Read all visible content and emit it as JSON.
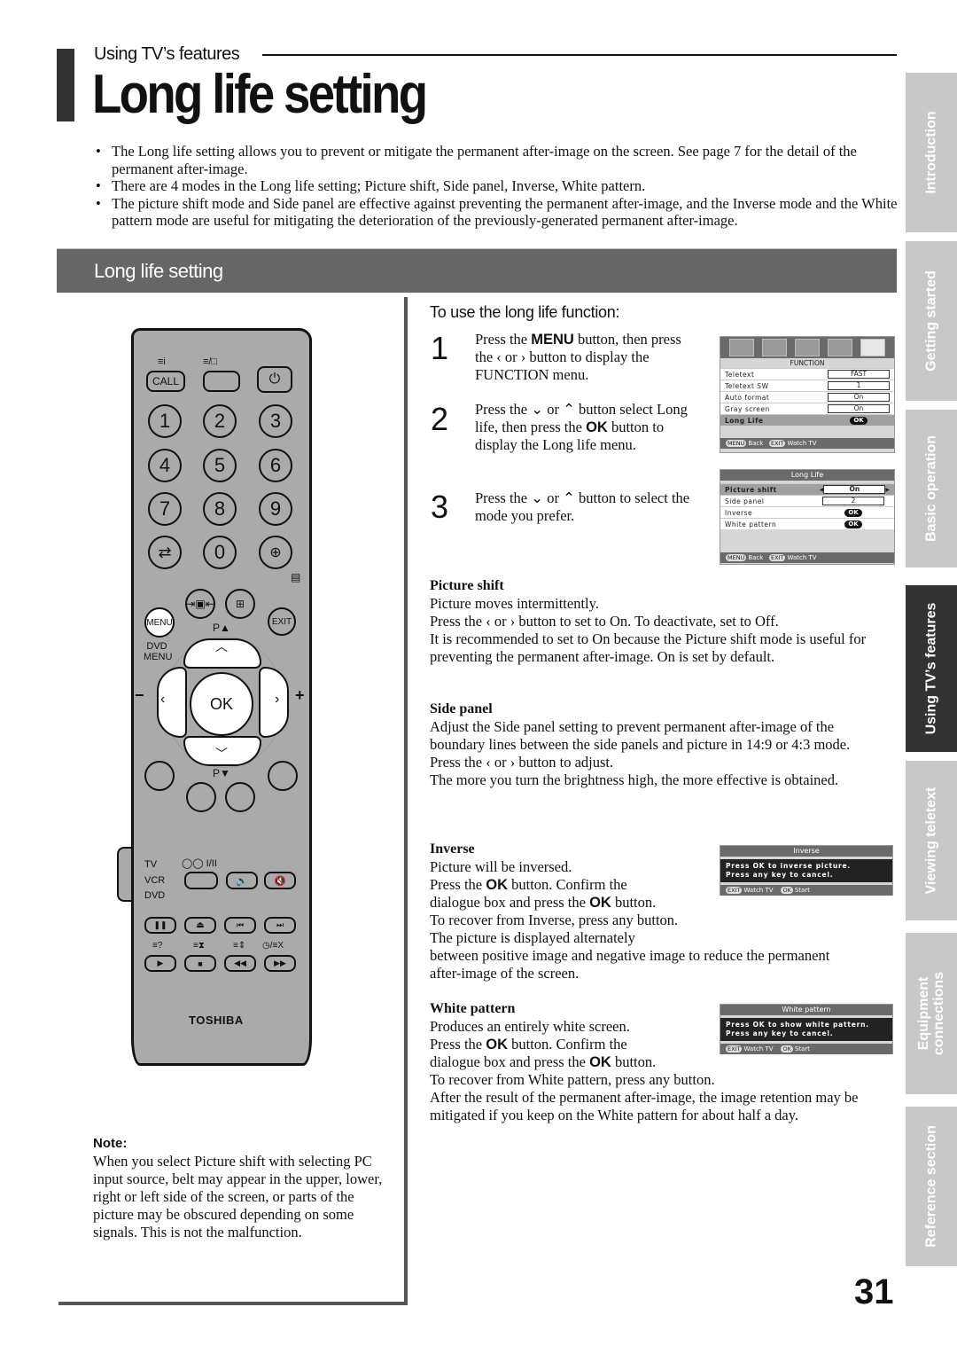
{
  "header": {
    "section": "Using TV’s features",
    "title": "Long life setting"
  },
  "intro_bullets": [
    "The Long life setting allows you to prevent or mitigate the permanent after-image on the screen. See page 7 for the detail of the permanent after-image.",
    "There are 4 modes in the Long life setting; Picture shift, Side panel, Inverse, White pattern.",
    "The picture shift mode and Side panel are effective against preventing the permanent after-image, and the Inverse mode and the White pattern mode are useful for mitigating the deterioration of the previously-generated permanent after-image."
  ],
  "band_title": "Long life setting",
  "side_tabs": [
    {
      "label": "Introduction",
      "active": false
    },
    {
      "label": "Getting started",
      "active": false
    },
    {
      "label": "Basic operation",
      "active": false
    },
    {
      "label": "Using TV’s features",
      "active": true
    },
    {
      "label": "Viewing teletext",
      "active": false
    },
    {
      "label": "Equipment connections",
      "active": false
    },
    {
      "label": "Reference section",
      "active": false
    }
  ],
  "remote": {
    "top_labels": {
      "call": "CALL",
      "text_icon": "≡i",
      "text_mix": "≡/□"
    },
    "numbers": [
      "1",
      "2",
      "3",
      "4",
      "5",
      "6",
      "7",
      "8",
      "9",
      "0"
    ],
    "menu": "MENU",
    "exit": "EXIT",
    "dvd_menu": "DVD MENU",
    "p_up": "P▲",
    "p_down": "P▼",
    "ok": "OK",
    "vol_minus": "−",
    "vol_plus": "+",
    "source": [
      "TV",
      "VCR",
      "DVD"
    ],
    "dual": "◯◯ I/II",
    "brand": "TOSHIBA"
  },
  "steps": {
    "heading": "To use the long life function:",
    "items": [
      {
        "num": "1",
        "parts": [
          "Press the ",
          "MENU",
          " button, then press the ‹ or › button to display the FUNCTION menu."
        ]
      },
      {
        "num": "2",
        "parts": [
          "Press the ⌄ or ⌃ button select Long life, then press the ",
          "OK",
          " button to display the Long life menu."
        ]
      },
      {
        "num": "3",
        "parts": [
          "Press the ⌄ or ⌃ button to select the mode you prefer."
        ]
      }
    ]
  },
  "osd_function": {
    "caption": "FUNCTION",
    "rows": [
      {
        "label": "Teletext",
        "value": "FAST"
      },
      {
        "label": "Teletext SW",
        "value": "1"
      },
      {
        "label": "Auto format",
        "value": "On"
      },
      {
        "label": "Gray screen",
        "value": "On"
      },
      {
        "label": "Long Life",
        "value": "OK",
        "highlight": true
      }
    ],
    "footer_menu": "MENU",
    "footer_back": "Back",
    "footer_exit": "EXIT",
    "footer_watch": "Watch TV"
  },
  "osd_longlife": {
    "title": "Long Life",
    "rows": [
      {
        "label": "Picture shift",
        "value": "On",
        "highlight": true
      },
      {
        "label": "Side panel",
        "value": "2"
      },
      {
        "label": "Inverse",
        "value": "OK"
      },
      {
        "label": "White pattern",
        "value": "OK"
      }
    ],
    "footer_menu": "MENU",
    "footer_back": "Back",
    "footer_exit": "EXIT",
    "footer_watch": "Watch TV"
  },
  "modes": {
    "picture_shift": {
      "title": "Picture shift",
      "lines": [
        "Picture moves intermittently.",
        "Press the ‹ or › button to set to On. To deactivate, set to Off.",
        "It is recommended to set to On because the Picture shift mode is useful for preventing the permanent after-image. On is set by default."
      ]
    },
    "side_panel": {
      "title": "Side panel",
      "lines": [
        "Adjust the Side panel setting to prevent permanent after-image of the boundary lines between the side panels and picture in 14:9 or 4:3 mode.",
        "Press the ‹ or › button to adjust.",
        "The more you turn the brightness high, the more effective is obtained."
      ]
    },
    "inverse": {
      "title": "Inverse",
      "line1": "Picture will be inversed.",
      "line2a": "Press the ",
      "ok": "OK",
      "line2b": " button. Confirm the",
      "line3a": "dialogue box and press the ",
      "line3b": " button.",
      "rest": [
        "To recover from Inverse, press any button.",
        "The picture is displayed alternately",
        "between positive image and negative image to reduce the permanent after-image of the screen."
      ],
      "osd": {
        "title": "Inverse",
        "msg1": "Press OK to inverse picture.",
        "msg2": "Press any key to cancel.",
        "exit": "EXIT",
        "watch": "Watch TV",
        "ok": "OK",
        "start": "Start"
      }
    },
    "white_pattern": {
      "title": "White pattern",
      "line1": "Produces an entirely white screen.",
      "line2a": "Press the ",
      "ok": "OK",
      "line2b": " button. Confirm the",
      "line3a": "dialogue box and press the ",
      "line3b": " button.",
      "rest": [
        "To recover from White pattern, press any button.",
        "After the result of the permanent after-image, the image retention may be mitigated if you keep on the White pattern for about half a day."
      ],
      "osd": {
        "title": "White pattern",
        "msg1": "Press OK to show white pattern.",
        "msg2": "Press any key to cancel.",
        "exit": "EXIT",
        "watch": "Watch TV",
        "ok": "OK",
        "start": "Start"
      }
    }
  },
  "note": {
    "title": "Note:",
    "text": "When you select Picture shift with selecting PC input source, belt may appear in the upper, lower, right or left side of the screen, or parts of the picture may be obscured depending on some signals. This is not the malfunction."
  },
  "page_number": "31"
}
